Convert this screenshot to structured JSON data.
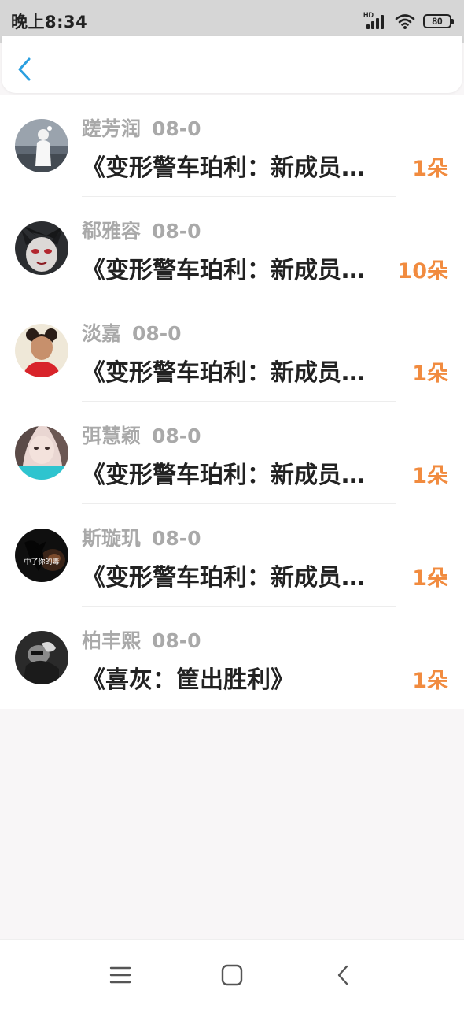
{
  "status_bar": {
    "time": "晚上8:34",
    "network_label": "HD",
    "battery_level": "80"
  },
  "header": {
    "back_icon": "chevron-left-icon",
    "accent_color": "#2a9fe0"
  },
  "gifts": [
    {
      "name": "蹉芳润",
      "date": "08-0",
      "title": "《变形警车珀利：新成员…",
      "count": "1朵"
    },
    {
      "name": "郗雅容",
      "date": "08-0",
      "title": "《变形警车珀利：新成员…",
      "count": "10朵"
    },
    {
      "name": "淡嘉",
      "date": "08-0",
      "title": "《变形警车珀利：新成员…",
      "count": "1朵"
    },
    {
      "name": "弭慧颖",
      "date": "08-0",
      "title": "《变形警车珀利：新成员…",
      "count": "1朵"
    },
    {
      "name": "斯璇玑",
      "date": "08-0",
      "title": "《变形警车珀利：新成员…",
      "count": "1朵"
    },
    {
      "name": "柏丰熙",
      "date": "08-0",
      "title": "《喜灰：筐出胜利》",
      "count": "1朵"
    }
  ],
  "avatar_badge": "中了你的毒",
  "colors": {
    "count": "#f18b3f",
    "name": "#a9a9a9",
    "title": "#222222",
    "page_background": "#f8f6f7"
  },
  "nav": {
    "menu_icon": "menu-icon",
    "home_icon": "home-icon",
    "back_icon": "back-icon"
  }
}
